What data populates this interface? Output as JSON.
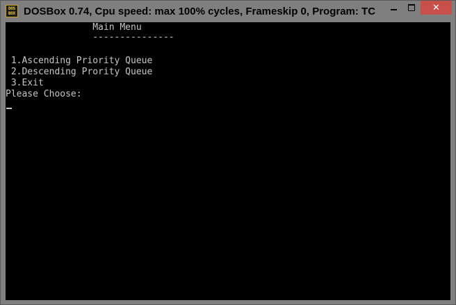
{
  "window": {
    "title": "DOSBox 0.74, Cpu speed: max 100% cycles, Frameskip  0, Program:    TC",
    "icon_label_top": "DOS",
    "icon_label_bottom": "BOX",
    "icon": "dosbox-icon",
    "controls": {
      "minimize_icon": "minimize-icon",
      "maximize_icon": "maximize-icon",
      "close_icon": "close-icon",
      "close_glyph": "✕"
    },
    "close_color": "#c7504b"
  },
  "screen": {
    "lines": [
      "                Main Menu",
      "                ---------------",
      "",
      " 1.Ascending Priority Queue",
      " 2.Descending Prority Queue",
      " 3.Exit",
      "Please Choose:"
    ],
    "text_color": "#c6c6c6",
    "background": "#000000"
  }
}
